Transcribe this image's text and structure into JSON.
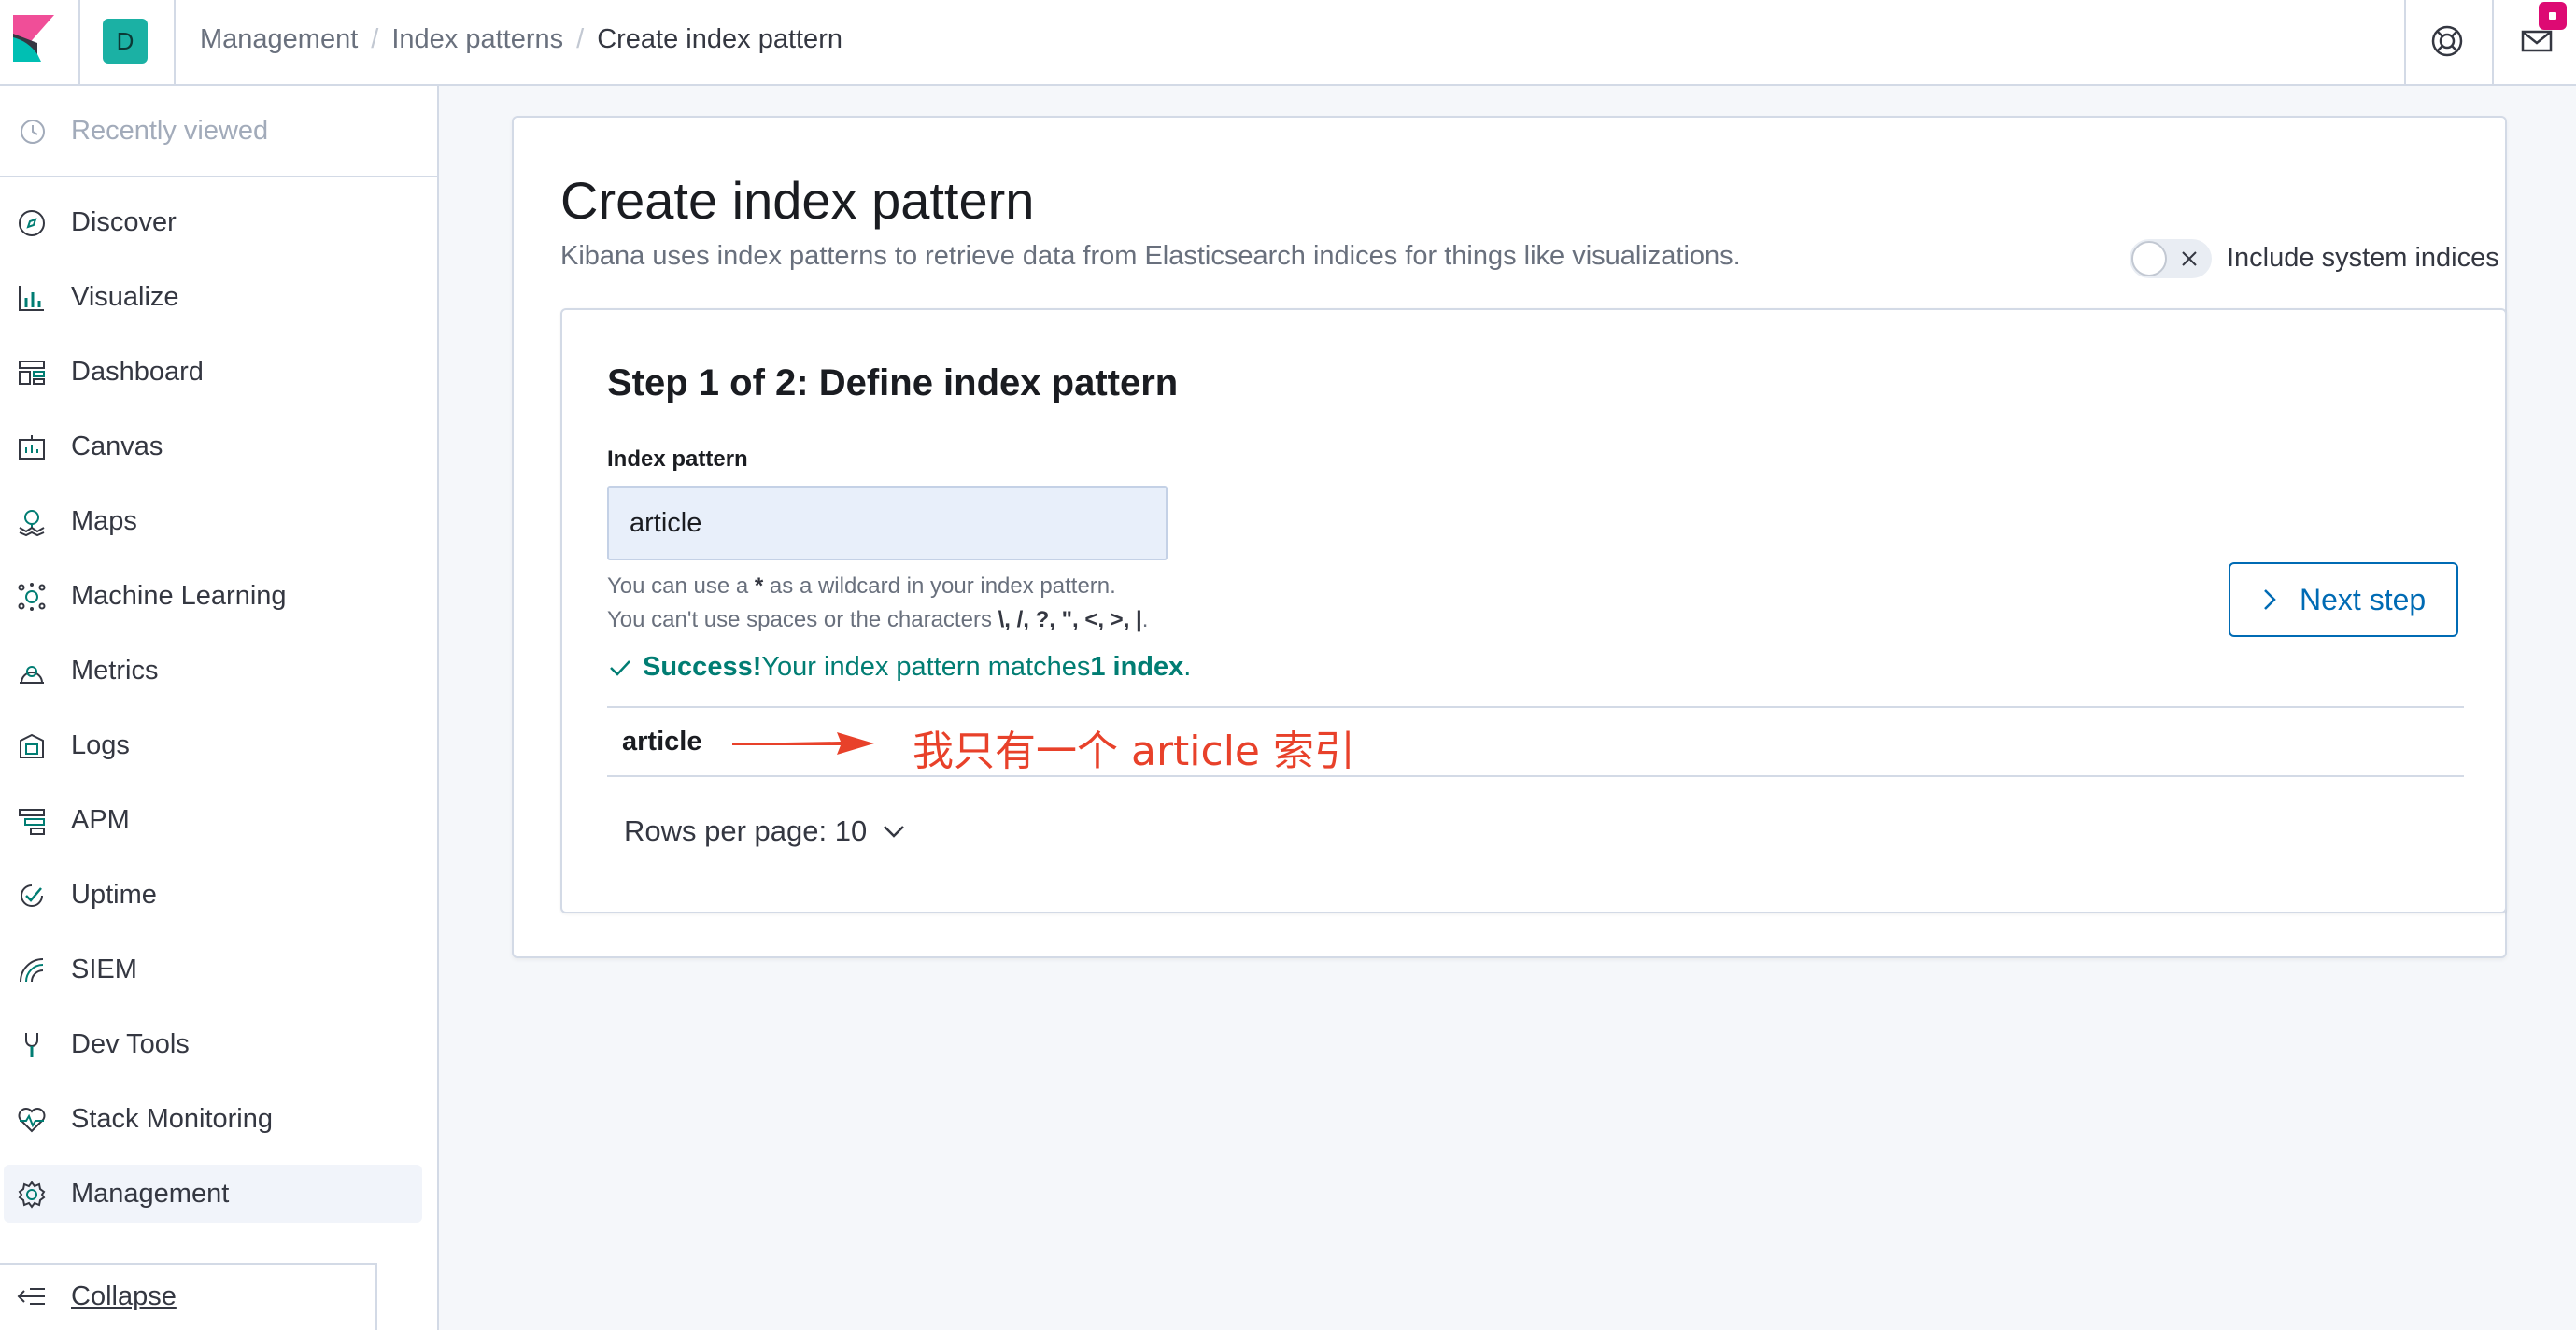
{
  "header": {
    "space_initial": "D",
    "breadcrumbs": [
      "Management",
      "Index patterns",
      "Create index pattern"
    ],
    "separator": "/",
    "accent": "#1bb1a4",
    "notification_color": "#dd0a73"
  },
  "sidebar": {
    "recently_viewed": "Recently viewed",
    "items": [
      {
        "label": "Discover",
        "icon": "compass-icon"
      },
      {
        "label": "Visualize",
        "icon": "visualize-icon"
      },
      {
        "label": "Dashboard",
        "icon": "dashboard-icon"
      },
      {
        "label": "Canvas",
        "icon": "canvas-icon"
      },
      {
        "label": "Maps",
        "icon": "maps-icon"
      },
      {
        "label": "Machine Learning",
        "icon": "machine-learning-icon"
      },
      {
        "label": "Metrics",
        "icon": "metrics-icon"
      },
      {
        "label": "Logs",
        "icon": "logs-icon"
      },
      {
        "label": "APM",
        "icon": "apm-icon"
      },
      {
        "label": "Uptime",
        "icon": "uptime-icon"
      },
      {
        "label": "SIEM",
        "icon": "siem-icon"
      },
      {
        "label": "Dev Tools",
        "icon": "dev-tools-icon"
      },
      {
        "label": "Stack Monitoring",
        "icon": "monitoring-icon"
      },
      {
        "label": "Management",
        "icon": "gear-icon"
      }
    ],
    "active": "Management",
    "collapse_label": "Collapse"
  },
  "main": {
    "title": "Create index pattern",
    "description": "Kibana uses index patterns to retrieve data from Elasticsearch indices for things like visualizations.",
    "include_system_indices": "Include system indices",
    "include_system_indices_enabled": false,
    "step": {
      "title": "Step 1 of 2: Define index pattern",
      "field_label": "Index pattern",
      "input_value": "article",
      "help_line_1_prefix": "You can use a ",
      "help_line_1_wildcard": "*",
      "help_line_1_suffix": " as a wildcard in your index pattern.",
      "help_line_2_prefix": "You can't use spaces or the characters ",
      "help_line_2_chars": "\\, /, ?, \", <, >, |",
      "help_line_2_suffix": ".",
      "success_label": "Success!",
      "success_text": " Your index pattern matches ",
      "success_count": "1 index",
      "success_end": ".",
      "results": [
        "article"
      ],
      "annotation": "我只有一个 article 索引",
      "rows_per_page": "Rows per page: 10",
      "next_button": "Next step"
    },
    "success_color": "#017d73",
    "link_color": "#006bb4",
    "annotation_color": "#e8412a"
  }
}
